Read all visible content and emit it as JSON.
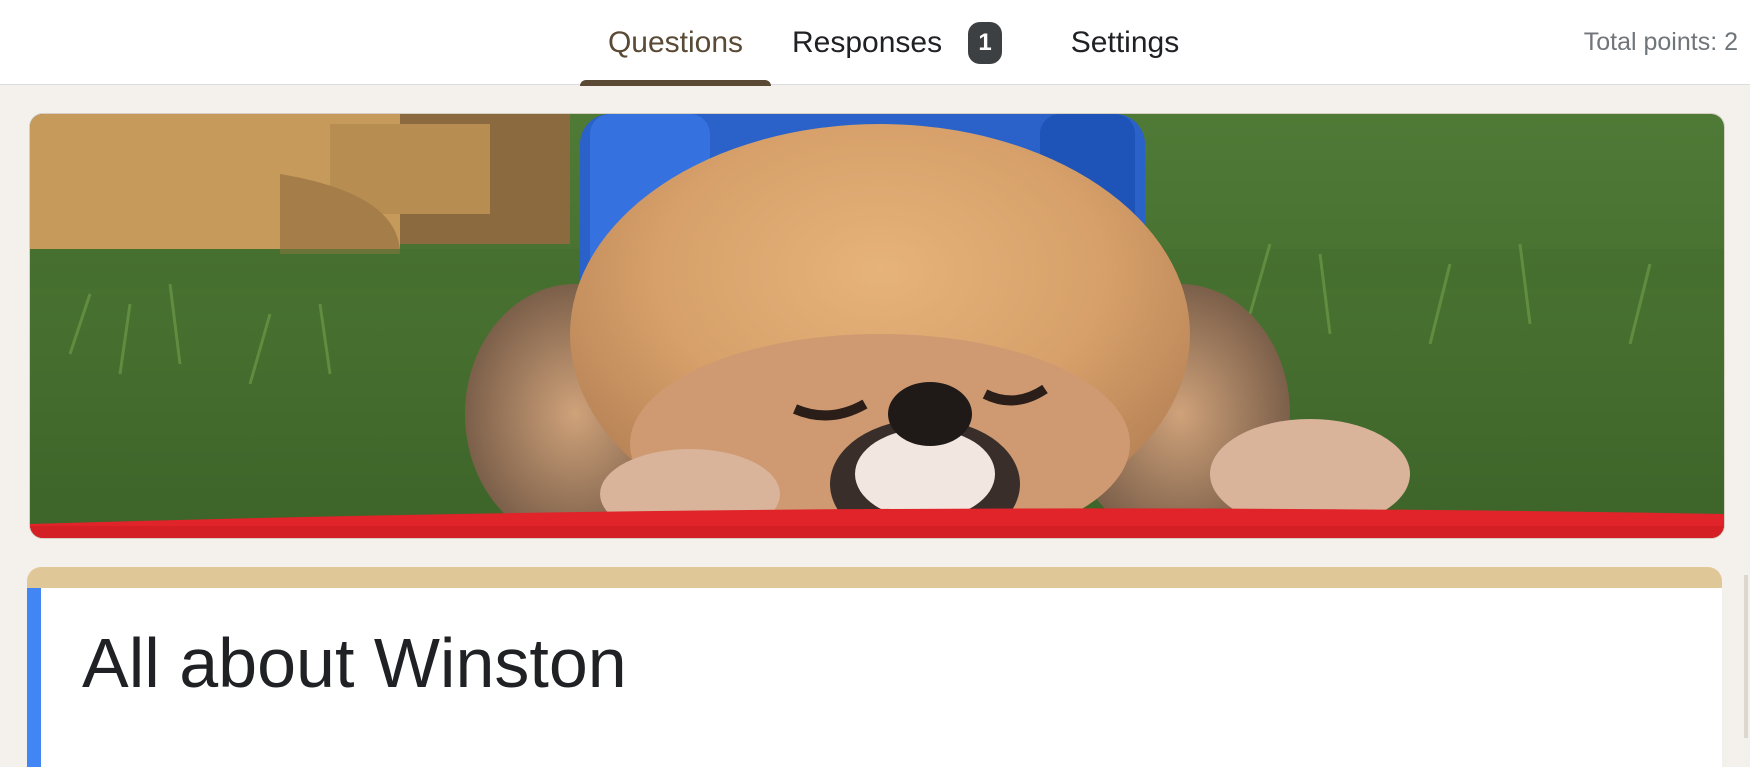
{
  "tabs": {
    "questions": "Questions",
    "responses": "Responses",
    "responses_count": "1",
    "settings": "Settings",
    "active": "questions"
  },
  "header": {
    "total_points": "Total points: 2"
  },
  "banner": {
    "image": "pekingese-dog-photo",
    "scene": "fluffy tan dog resting chin on red surface with grass and blue slide behind"
  },
  "form": {
    "title": "All about Winston"
  },
  "colors": {
    "accent_dark": "#5a4a35",
    "header_strip": "#dfc797",
    "focus_bar": "#4285f4",
    "page_background": "#f4f1ec",
    "badge": "#3c4043"
  }
}
